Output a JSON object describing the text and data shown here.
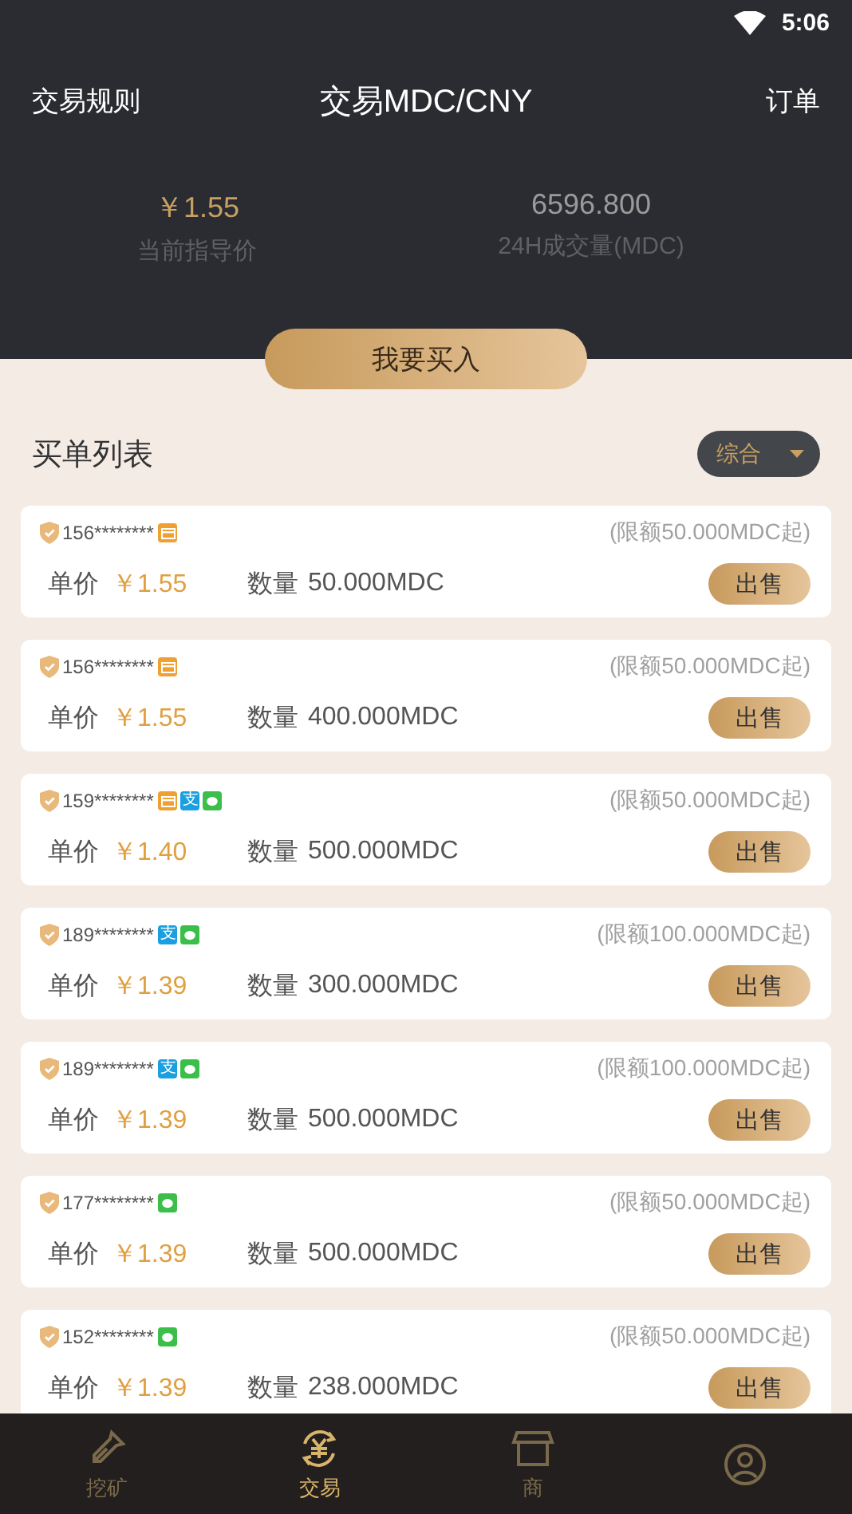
{
  "status_bar": {
    "time": "5:06"
  },
  "header": {
    "left": "交易规则",
    "title": "交易MDC/CNY",
    "right": "订单"
  },
  "stats": [
    {
      "value": "￥1.55",
      "label": "当前指导价",
      "kind": "price"
    },
    {
      "value": "6596.800",
      "label": "24H成交量(MDC)",
      "kind": "volume"
    }
  ],
  "buy_button": "我要买入",
  "list": {
    "title": "买单列表",
    "sort": "综合"
  },
  "orders": [
    {
      "user": "156********",
      "payments": [
        {
          "kind": "card"
        }
      ],
      "limit": "(限额50.000MDC起)",
      "price_label": "单价",
      "price": "￥1.55",
      "qty_label": "数量",
      "qty": "50.000MDC",
      "action": "出售"
    },
    {
      "user": "156********",
      "payments": [
        {
          "kind": "card"
        }
      ],
      "limit": "(限额50.000MDC起)",
      "price_label": "单价",
      "price": "￥1.55",
      "qty_label": "数量",
      "qty": "400.000MDC",
      "action": "出售"
    },
    {
      "user": "159********",
      "payments": [
        {
          "kind": "card"
        },
        {
          "kind": "alipay",
          "label": "支"
        },
        {
          "kind": "wechat"
        }
      ],
      "limit": "(限额50.000MDC起)",
      "price_label": "单价",
      "price": "￥1.40",
      "qty_label": "数量",
      "qty": "500.000MDC",
      "action": "出售"
    },
    {
      "user": "189********",
      "payments": [
        {
          "kind": "alipay",
          "label": "支"
        },
        {
          "kind": "wechat"
        }
      ],
      "limit": "(限额100.000MDC起)",
      "price_label": "单价",
      "price": "￥1.39",
      "qty_label": "数量",
      "qty": "300.000MDC",
      "action": "出售"
    },
    {
      "user": "189********",
      "payments": [
        {
          "kind": "alipay",
          "label": "支"
        },
        {
          "kind": "wechat"
        }
      ],
      "limit": "(限额100.000MDC起)",
      "price_label": "单价",
      "price": "￥1.39",
      "qty_label": "数量",
      "qty": "500.000MDC",
      "action": "出售"
    },
    {
      "user": "177********",
      "payments": [
        {
          "kind": "wechat"
        }
      ],
      "limit": "(限额50.000MDC起)",
      "price_label": "单价",
      "price": "￥1.39",
      "qty_label": "数量",
      "qty": "500.000MDC",
      "action": "出售"
    },
    {
      "user": "152********",
      "payments": [
        {
          "kind": "wechat"
        }
      ],
      "limit": "(限额50.000MDC起)",
      "price_label": "单价",
      "price": "￥1.39",
      "qty_label": "数量",
      "qty": "238.000MDC",
      "action": "出售"
    }
  ],
  "tabs": [
    {
      "label": "挖矿",
      "kind": "mining",
      "selected": false
    },
    {
      "label": "交易",
      "kind": "trade",
      "selected": true
    },
    {
      "label": "商",
      "kind": "shop",
      "selected": false
    },
    {
      "kind": "profile",
      "selected": false
    }
  ]
}
